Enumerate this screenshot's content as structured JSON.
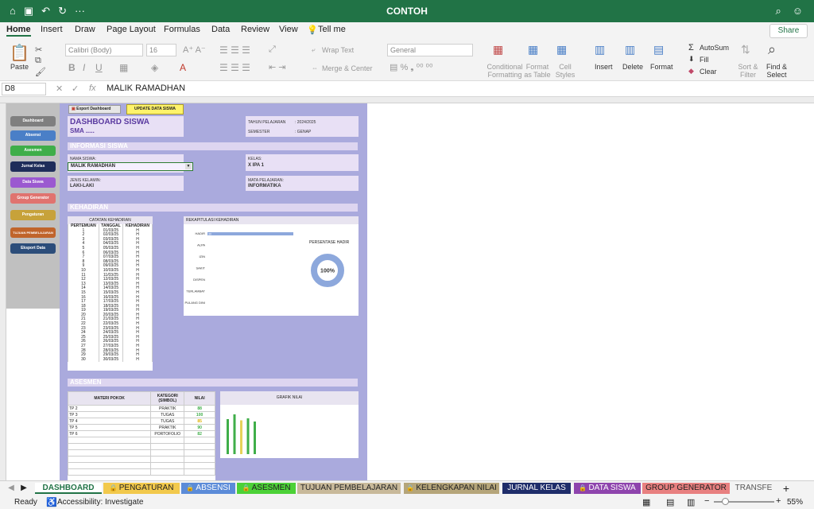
{
  "app": {
    "title": "CONTOH"
  },
  "menu": {
    "tabs": [
      "Home",
      "Insert",
      "Draw",
      "Page Layout",
      "Formulas",
      "Data",
      "Review",
      "View"
    ],
    "tell_me": "Tell me",
    "share": "Share"
  },
  "ribbon": {
    "paste": "Paste",
    "font_name": "Calibri (Body)",
    "font_size": "16",
    "wrap_text": "Wrap Text",
    "merge_center": "Merge & Center",
    "number_format": "General",
    "conditional_formatting": "Conditional Formatting",
    "format_as_table": "Format as Table",
    "cell_styles": "Cell Styles",
    "insert": "Insert",
    "delete": "Delete",
    "format": "Format",
    "autosum": "AutoSum",
    "fill": "Fill",
    "clear": "Clear",
    "sort_filter": "Sort & Filter",
    "find_select": "Find & Select"
  },
  "formula_bar": {
    "cell_ref": "D8",
    "fx": "fx",
    "value": "MALIK RAMADHAN"
  },
  "sidebar": {
    "buttons": [
      {
        "label": "Dashboard",
        "color": "#7f7f7f"
      },
      {
        "label": "Absensi",
        "color": "#4a7fc7"
      },
      {
        "label": "Asesmen",
        "color": "#3fae49"
      },
      {
        "label": "Jurnal Kelas",
        "color": "#1f2d5a"
      },
      {
        "label": "Data Siswa",
        "color": "#9b59d0"
      },
      {
        "label": "Group Generator",
        "color": "#e0736f"
      },
      {
        "label": "Pengaturan",
        "color": "#c7a23a"
      },
      {
        "label": "TUJUAN PEMBELAJARAN",
        "color": "#c0642b"
      },
      {
        "label": "Eksport Data",
        "color": "#2c4d7a"
      }
    ]
  },
  "dashboard": {
    "export_button": "Export Dashboard",
    "update_button": "UPDATE DATA SISWA",
    "title": "DASHBOARD SISWA",
    "school": "SMA .....",
    "tahun_label": "TAHUN PELAJARAN",
    "tahun_value": ": 2024/2025",
    "semester_label": "SEMESTER",
    "semester_value": ": GENAP",
    "info_section": "INFORMASI SISWA",
    "nama_label": "NAMA SISWA:",
    "nama_value": "MALIK RAMADHAN",
    "kelas_label": "KELAS:",
    "kelas_value": "X IPA 1",
    "jk_label": "JENIS KELAMIN:",
    "jk_value": "LAKI-LAKI",
    "mapel_label": "MATA PELAJARAN:",
    "mapel_value": "INFORMATIKA",
    "kehadiran_section": "KEHADIRAN",
    "catatan_title": "CATATAN KEHADIRAN",
    "att_headers": [
      "PERTEMUAN",
      "TANGGAL",
      "KEHADIRAN"
    ],
    "attendance": [
      [
        "1",
        "01/03/25",
        "H"
      ],
      [
        "2",
        "02/03/25",
        "H"
      ],
      [
        "3",
        "03/03/25",
        "H"
      ],
      [
        "4",
        "04/03/25",
        "H"
      ],
      [
        "5",
        "05/03/25",
        "H"
      ],
      [
        "6",
        "06/03/25",
        "H"
      ],
      [
        "7",
        "07/03/25",
        "H"
      ],
      [
        "8",
        "08/03/25",
        "H"
      ],
      [
        "9",
        "09/03/25",
        "H"
      ],
      [
        "10",
        "10/03/25",
        "H"
      ],
      [
        "11",
        "11/03/25",
        "H"
      ],
      [
        "12",
        "12/03/25",
        "H"
      ],
      [
        "13",
        "13/03/25",
        "H"
      ],
      [
        "14",
        "14/03/25",
        "H"
      ],
      [
        "15",
        "15/03/25",
        "H"
      ],
      [
        "16",
        "16/03/25",
        "H"
      ],
      [
        "17",
        "17/03/25",
        "H"
      ],
      [
        "18",
        "18/03/25",
        "H"
      ],
      [
        "19",
        "19/03/25",
        "H"
      ],
      [
        "20",
        "20/03/25",
        "H"
      ],
      [
        "21",
        "21/03/25",
        "H"
      ],
      [
        "22",
        "22/03/25",
        "H"
      ],
      [
        "23",
        "23/03/25",
        "H"
      ],
      [
        "24",
        "24/03/25",
        "H"
      ],
      [
        "25",
        "25/03/25",
        "H"
      ],
      [
        "26",
        "26/03/25",
        "H"
      ],
      [
        "27",
        "27/03/25",
        "H"
      ],
      [
        "28",
        "28/03/25",
        "H"
      ],
      [
        "29",
        "29/03/25",
        "H"
      ],
      [
        "30",
        "30/03/25",
        "H"
      ]
    ],
    "rekap_title": "REKAPITULASI KEHADIRAN",
    "persentase_label": "PERSENTASE HADIR",
    "persentase_value": "100%",
    "asesmen_section": "ASESMEN",
    "asm_headers": [
      "MATERI POKOK",
      "KATEGORI (SIMBOL)",
      "NILAI"
    ],
    "asesmen": [
      {
        "materi": "TP 2",
        "kategori": "PRAKTIK",
        "nilai": "88",
        "color": "#3fae49"
      },
      {
        "materi": "TP 3",
        "kategori": "TUGAS",
        "nilai": "100",
        "color": "#3fae49"
      },
      {
        "materi": "TP 4",
        "kategori": "TUGAS",
        "nilai": "85",
        "color": "#e0b000"
      },
      {
        "materi": "TP 5",
        "kategori": "PRAKTIK",
        "nilai": "90",
        "color": "#3fae49"
      },
      {
        "materi": "TP 6",
        "kategori": "PORTOFOLIO",
        "nilai": "82",
        "color": "#3fae49"
      }
    ],
    "grafik_title": "GRAFIK NILAI"
  },
  "chart_data": [
    {
      "type": "bar",
      "title": "REKAPITULASI KEHADIRAN",
      "categories": [
        "HADIR",
        "ALPA",
        "IZIN",
        "SAKIT",
        "DISPEN",
        "TERLAMBAT",
        "PULANG DINI"
      ],
      "values": [
        30,
        0,
        0,
        0,
        0,
        0,
        0
      ]
    },
    {
      "type": "pie",
      "title": "PERSENTASE HADIR",
      "values": [
        100
      ],
      "label": "100%"
    },
    {
      "type": "bar",
      "title": "GRAFIK NILAI",
      "categories": [
        "TP 2",
        "TP 3",
        "TP 4",
        "TP 5",
        "TP 6"
      ],
      "values": [
        88,
        100,
        85,
        90,
        82
      ],
      "colors": [
        "#3fae49",
        "#3fae49",
        "#e6d25a",
        "#3fae49",
        "#3fae49"
      ]
    }
  ],
  "sheet_tabs": [
    {
      "label": "DASHBOARD",
      "bg": "#ffffff",
      "fg": "#217346",
      "lock": false,
      "active": true
    },
    {
      "label": "PENGATURAN",
      "bg": "#f2c94c",
      "fg": "#222",
      "lock": true
    },
    {
      "label": "ABSENSI",
      "bg": "#5b8bd8",
      "fg": "#fff",
      "lock": true
    },
    {
      "label": "ASESMEN",
      "bg": "#4cd137",
      "fg": "#222",
      "lock": true
    },
    {
      "label": "TUJUAN PEMBELAJARAN",
      "bg": "#c8b99a",
      "fg": "#222",
      "lock": false
    },
    {
      "label": "KELENGKAPAN NILAI",
      "bg": "#b5a57a",
      "fg": "#222",
      "lock": true
    },
    {
      "label": "JURNAL KELAS",
      "bg": "#1f2d6a",
      "fg": "#fff",
      "lock": false
    },
    {
      "label": "DATA SISWA",
      "bg": "#8e44ad",
      "fg": "#fff",
      "lock": true
    },
    {
      "label": "GROUP GENERATOR",
      "bg": "#e88080",
      "fg": "#222",
      "lock": false
    },
    {
      "label": "TRANSFE",
      "bg": "#f3f3f3",
      "fg": "#555",
      "lock": false
    }
  ],
  "status": {
    "ready": "Ready",
    "accessibility": "Accessibility: Investigate",
    "zoom": "55%"
  }
}
